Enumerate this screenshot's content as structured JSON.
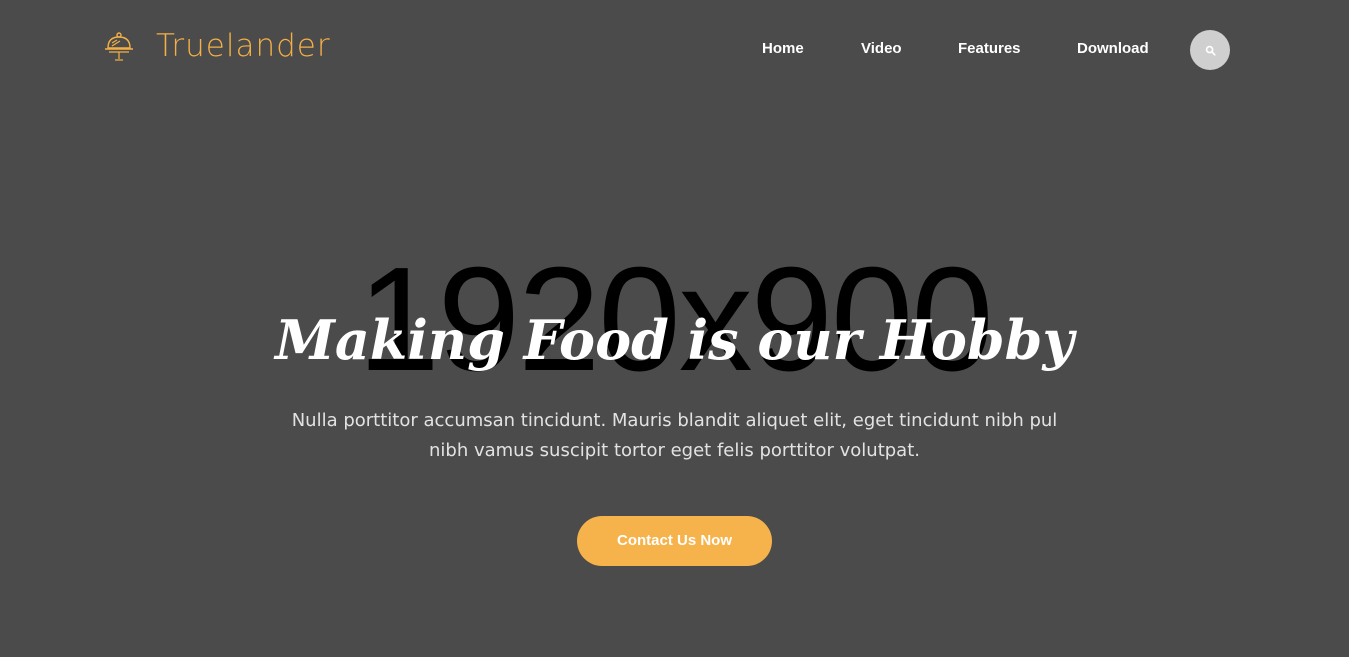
{
  "brand": {
    "name": "Truelander",
    "logo_icon": "cloche-icon",
    "color": "#f4b046"
  },
  "nav": {
    "items": [
      {
        "label": "Home"
      },
      {
        "label": "Video"
      },
      {
        "label": "Features"
      },
      {
        "label": "Download"
      }
    ],
    "search_icon": "search-icon"
  },
  "placeholder": {
    "text": "1920x900"
  },
  "hero": {
    "title": "Making Food is our Hobby",
    "text_line1": "Nulla porttitor accumsan tincidunt. Mauris blandit aliquet elit, eget tincidunt nibh pul",
    "text_line2": "nibh vamus suscipit tortor eget felis porttitor volutpat.",
    "cta_label": "Contact Us Now"
  },
  "colors": {
    "background": "#4b4b4b",
    "accent": "#f6b34c",
    "search_button": "#cfcfcf"
  }
}
